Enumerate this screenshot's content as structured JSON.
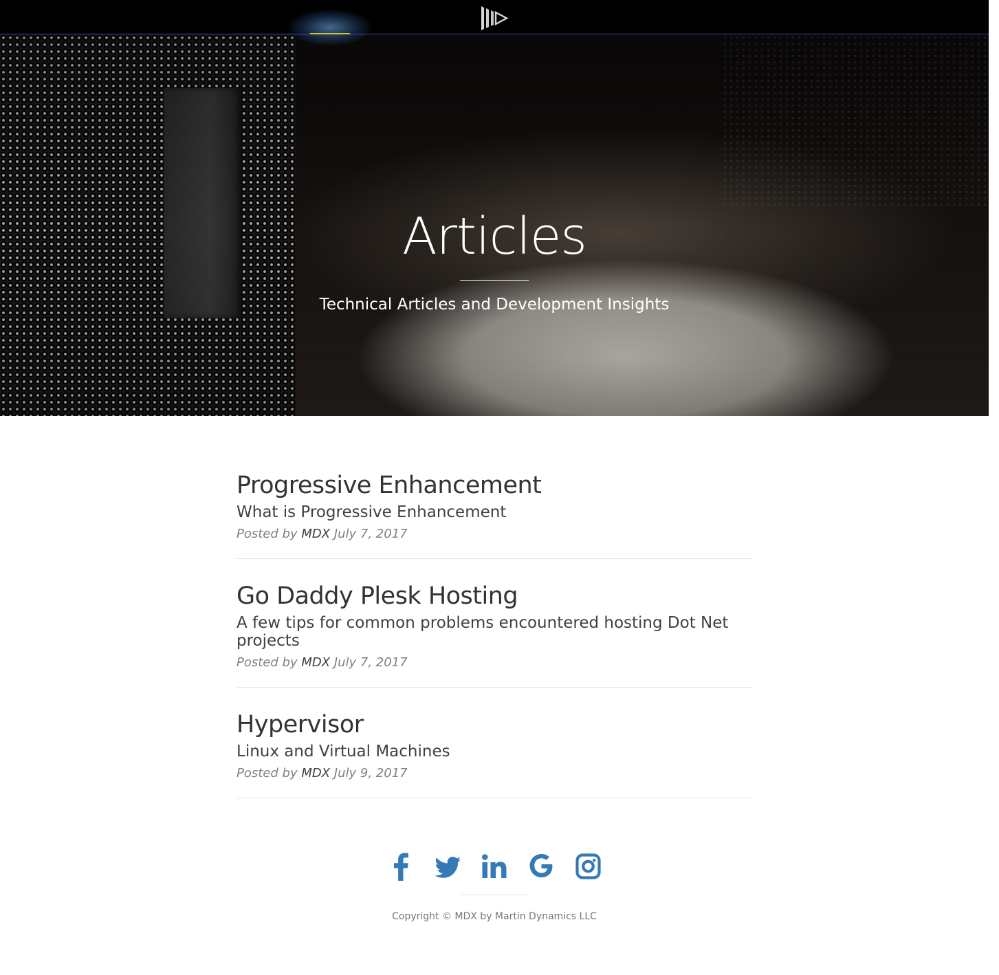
{
  "nav": {
    "logo_icon": "mdx-play-logo-icon",
    "active_indicator_color": "#cfc23a",
    "bar_color": "#000000",
    "bottom_border_color": "#3d47a8"
  },
  "hero": {
    "title": "Articles",
    "subtitle": "Technical Articles and Development Insights"
  },
  "posts": [
    {
      "title": "Progressive Enhancement",
      "subtitle": "What is Progressive Enhancement",
      "posted_by_label": "Posted by",
      "author": "MDX",
      "date": "July 7, 2017"
    },
    {
      "title": "Go Daddy Plesk Hosting",
      "subtitle": "A few tips for common problems encountered hosting Dot Net projects",
      "posted_by_label": "Posted by",
      "author": "MDX",
      "date": "July 7, 2017"
    },
    {
      "title": "Hypervisor",
      "subtitle": "Linux and Virtual Machines",
      "posted_by_label": "Posted by",
      "author": "MDX",
      "date": "July 9, 2017"
    }
  ],
  "footer": {
    "social_icons": [
      "facebook-icon",
      "twitter-icon",
      "linkedin-icon",
      "google-icon",
      "instagram-icon"
    ],
    "icon_color": "#337ab7",
    "copyright": "Copyright © MDX by Martin Dynamics LLC"
  }
}
